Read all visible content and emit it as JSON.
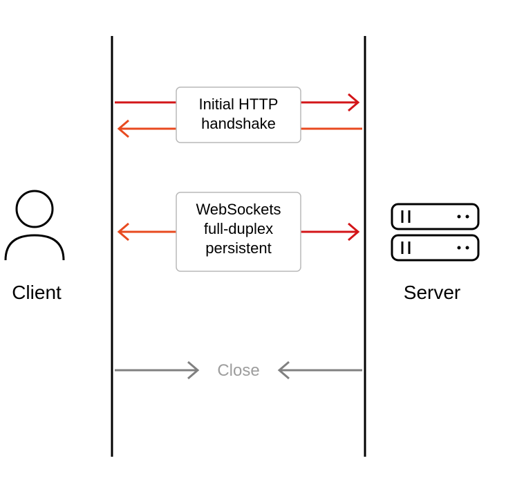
{
  "client_label": "Client",
  "server_label": "Server",
  "steps": {
    "handshake": {
      "line1": "Initial HTTP",
      "line2": "handshake"
    },
    "duplex": {
      "line1": "WebSockets",
      "line2": "full-duplex",
      "line3": "persistent"
    },
    "close": {
      "label": "Close"
    }
  },
  "colors": {
    "arrow_left": "#e84a1f",
    "arrow_right": "#d31518",
    "arrow_close": "#808080"
  }
}
